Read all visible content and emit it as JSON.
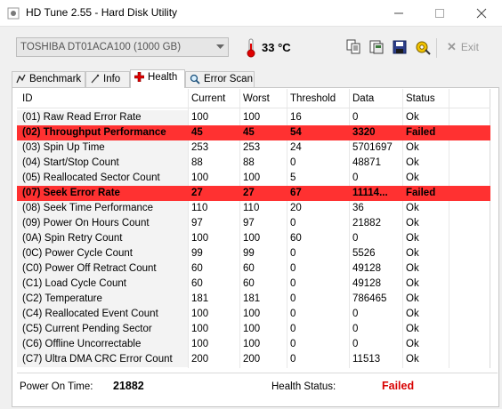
{
  "window": {
    "title": "HD Tune 2.55 - Hard Disk Utility"
  },
  "toolbar": {
    "drive": "TOSHIBA DT01ACA100 (1000 GB)",
    "temperature": "33 °C",
    "exit_label": "Exit"
  },
  "tabs": [
    {
      "label": "Benchmark",
      "icon": "benchmark-icon"
    },
    {
      "label": "Info",
      "icon": "info-icon"
    },
    {
      "label": "Health",
      "icon": "health-cross-icon",
      "active": true
    },
    {
      "label": "Error Scan",
      "icon": "magnifier-icon"
    }
  ],
  "table": {
    "headers": [
      "ID",
      "Current",
      "Worst",
      "Threshold",
      "Data",
      "Status"
    ],
    "rows": [
      {
        "id": "(01) Raw Read Error Rate",
        "current": "100",
        "worst": "100",
        "threshold": "16",
        "data": "0",
        "status": "Ok"
      },
      {
        "id": "(02) Throughput Performance",
        "current": "45",
        "worst": "45",
        "threshold": "54",
        "data": "3320",
        "status": "Failed"
      },
      {
        "id": "(03) Spin Up Time",
        "current": "253",
        "worst": "253",
        "threshold": "24",
        "data": "5701697",
        "status": "Ok"
      },
      {
        "id": "(04) Start/Stop Count",
        "current": "88",
        "worst": "88",
        "threshold": "0",
        "data": "48871",
        "status": "Ok"
      },
      {
        "id": "(05) Reallocated Sector Count",
        "current": "100",
        "worst": "100",
        "threshold": "5",
        "data": "0",
        "status": "Ok"
      },
      {
        "id": "(07) Seek Error Rate",
        "current": "27",
        "worst": "27",
        "threshold": "67",
        "data": "11114...",
        "status": "Failed"
      },
      {
        "id": "(08) Seek Time Performance",
        "current": "110",
        "worst": "110",
        "threshold": "20",
        "data": "36",
        "status": "Ok"
      },
      {
        "id": "(09) Power On Hours Count",
        "current": "97",
        "worst": "97",
        "threshold": "0",
        "data": "21882",
        "status": "Ok"
      },
      {
        "id": "(0A) Spin Retry Count",
        "current": "100",
        "worst": "100",
        "threshold": "60",
        "data": "0",
        "status": "Ok"
      },
      {
        "id": "(0C) Power Cycle Count",
        "current": "99",
        "worst": "99",
        "threshold": "0",
        "data": "5526",
        "status": "Ok"
      },
      {
        "id": "(C0) Power Off Retract Count",
        "current": "60",
        "worst": "60",
        "threshold": "0",
        "data": "49128",
        "status": "Ok"
      },
      {
        "id": "(C1) Load Cycle Count",
        "current": "60",
        "worst": "60",
        "threshold": "0",
        "data": "49128",
        "status": "Ok"
      },
      {
        "id": "(C2) Temperature",
        "current": "181",
        "worst": "181",
        "threshold": "0",
        "data": "786465",
        "status": "Ok"
      },
      {
        "id": "(C4) Reallocated Event Count",
        "current": "100",
        "worst": "100",
        "threshold": "0",
        "data": "0",
        "status": "Ok"
      },
      {
        "id": "(C5) Current Pending Sector",
        "current": "100",
        "worst": "100",
        "threshold": "0",
        "data": "0",
        "status": "Ok"
      },
      {
        "id": "(C6) Offline Uncorrectable",
        "current": "100",
        "worst": "100",
        "threshold": "0",
        "data": "0",
        "status": "Ok"
      },
      {
        "id": "(C7) Ultra DMA CRC Error Count",
        "current": "200",
        "worst": "200",
        "threshold": "0",
        "data": "11513",
        "status": "Ok"
      }
    ]
  },
  "footer": {
    "power_on_label": "Power On Time:",
    "power_on_value": "21882",
    "health_label": "Health Status:",
    "health_value": "Failed"
  },
  "colors": {
    "failed_row": "#ff3131",
    "failed_text": "#d80000",
    "temp_red": "#e00000"
  }
}
